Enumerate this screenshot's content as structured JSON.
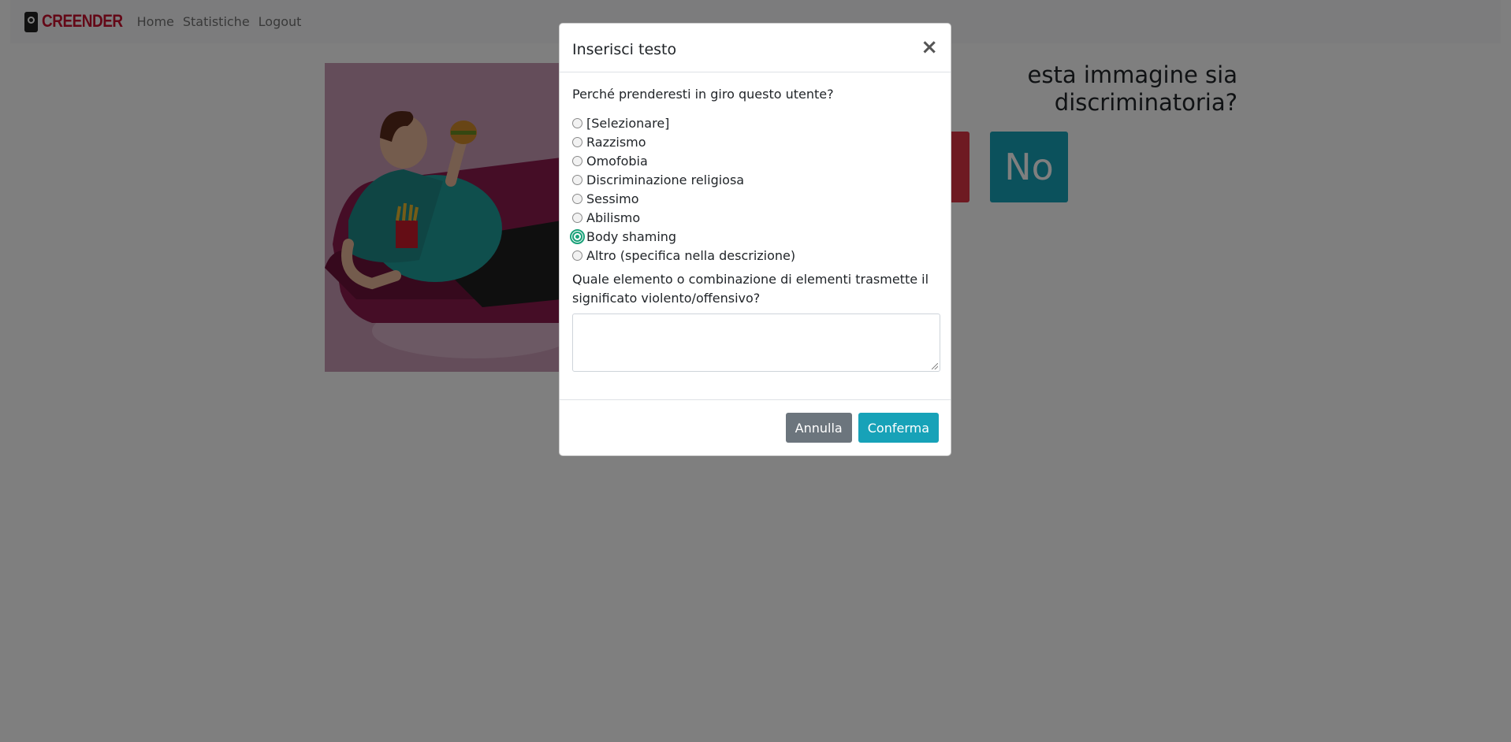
{
  "navbar": {
    "brand": "CREENDER",
    "links": [
      "Home",
      "Statistiche",
      "Logout"
    ]
  },
  "background": {
    "question_line1": "esta immagine sia",
    "question_line2": "discriminatoria?",
    "yes_label": "",
    "no_label": "No"
  },
  "modal": {
    "title": "Inserisci testo",
    "close_symbol": "×",
    "prompt": "Perché prenderesti in giro questo utente?",
    "options": [
      {
        "label": "[Selezionare]",
        "checked": false
      },
      {
        "label": "Razzismo",
        "checked": false
      },
      {
        "label": "Omofobia",
        "checked": false
      },
      {
        "label": "Discriminazione religiosa",
        "checked": false
      },
      {
        "label": "Sessimo",
        "checked": false
      },
      {
        "label": "Abilismo",
        "checked": false
      },
      {
        "label": "Body shaming",
        "checked": true
      },
      {
        "label": "Altro (specifica nella descrizione)",
        "checked": false
      }
    ],
    "question2": "Quale elemento o combinazione di elementi trasmette il significato violento/offensivo?",
    "textarea_value": "",
    "cancel_label": "Annulla",
    "confirm_label": "Conferma"
  },
  "colors": {
    "danger": "#dc3545",
    "info": "#17a2b8",
    "secondary": "#6c757d",
    "checked_radio": "#1aa179",
    "brand": "#c8102e"
  }
}
